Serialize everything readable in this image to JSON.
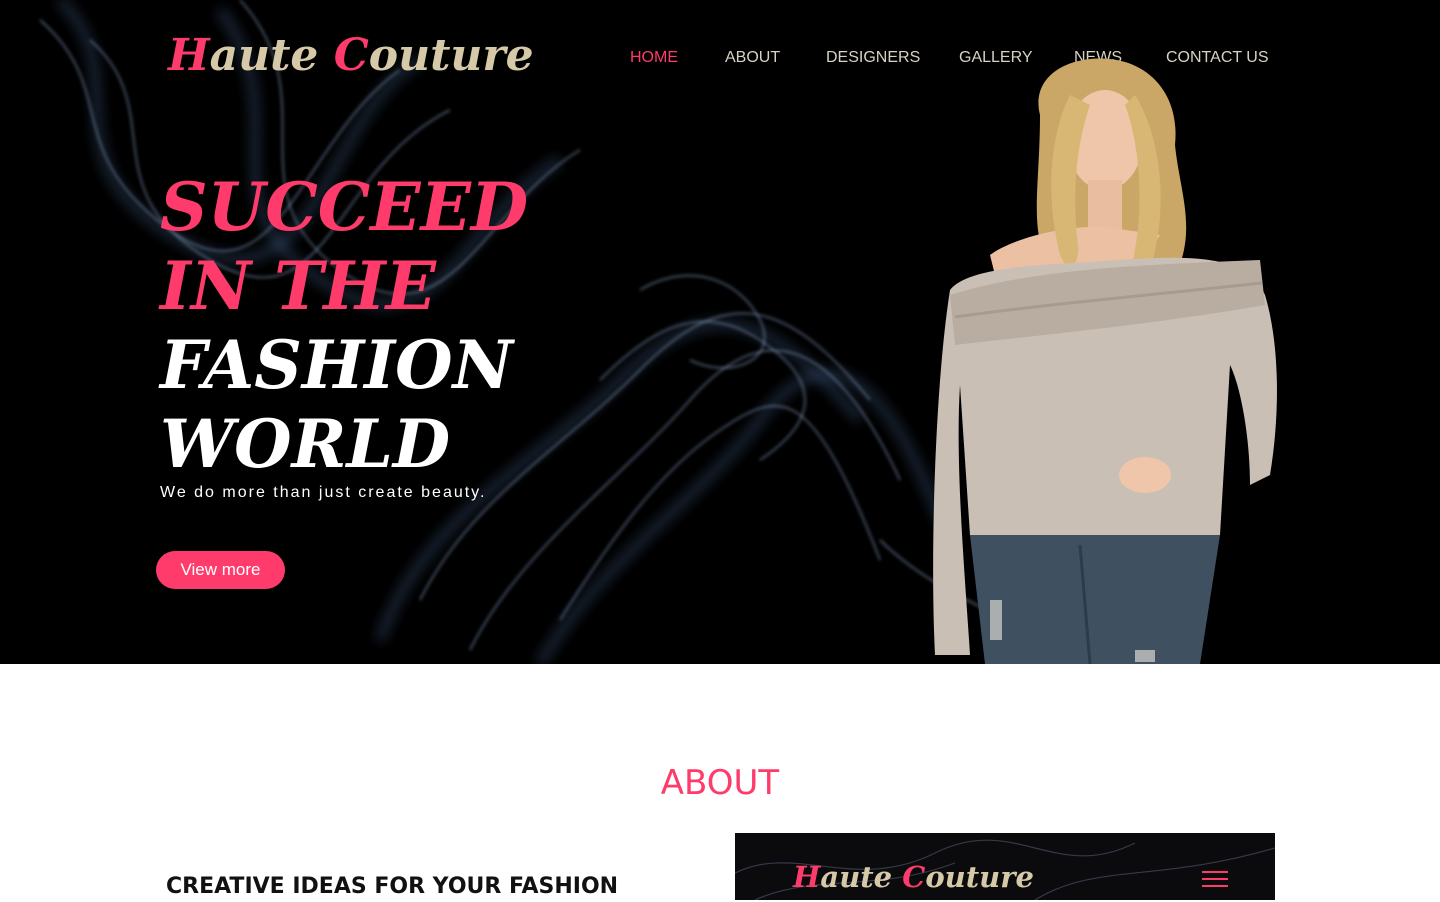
{
  "brand": {
    "logo_parts": [
      {
        "text": "H",
        "accent": true
      },
      {
        "text": "aute ",
        "accent": false
      },
      {
        "text": "C",
        "accent": true
      },
      {
        "text": "outure",
        "accent": false
      }
    ]
  },
  "nav": {
    "items": [
      {
        "label": "HOME",
        "active": true
      },
      {
        "label": "ABOUT",
        "active": false
      },
      {
        "label": "DESIGNERS",
        "active": false
      },
      {
        "label": "GALLERY",
        "active": false
      },
      {
        "label": "NEWS",
        "active": false
      },
      {
        "label": "CONTACT US",
        "active": false
      }
    ]
  },
  "hero": {
    "line1": "SUCCEED",
    "line2": "IN THE",
    "line3": "FASHION",
    "line4": "WORLD",
    "tagline": "We do more than just create beauty.",
    "cta_label": "View more"
  },
  "about": {
    "title": "ABOUT",
    "subtitle": "CREATIVE IDEAS FOR YOUR FASHION"
  },
  "colors": {
    "accent": "#ff3b6b",
    "logo_secondary": "#d6c9a8",
    "hero_bg": "#000000",
    "nav_text": "#d8d2c2"
  },
  "icons": {
    "menu": "hamburger-menu-icon"
  }
}
